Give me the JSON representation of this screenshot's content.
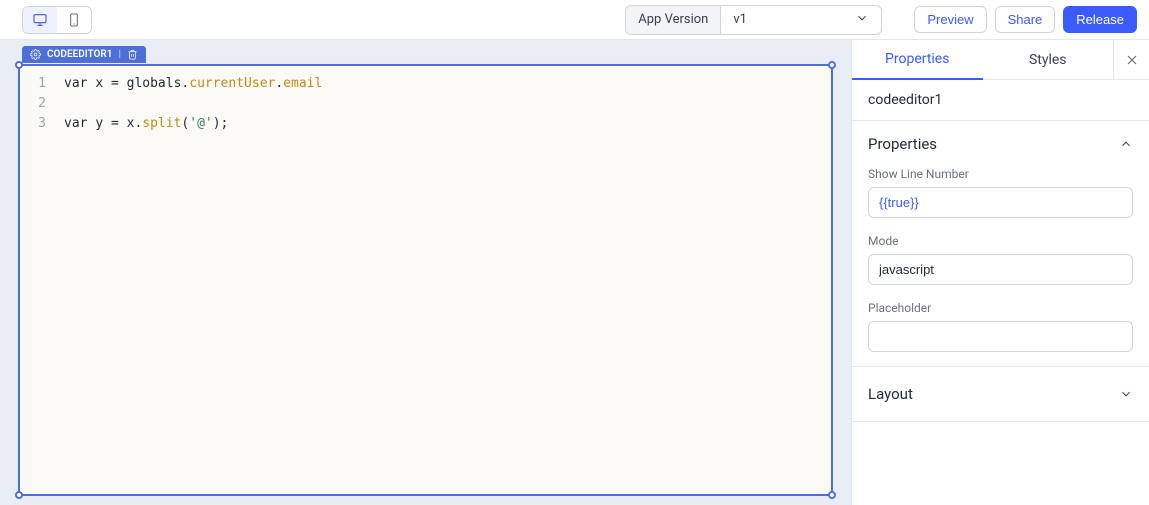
{
  "topbar": {
    "appVersionLabel": "App Version",
    "appVersionValue": "v1",
    "preview": "Preview",
    "share": "Share",
    "release": "Release"
  },
  "component": {
    "tag": "CODEEDITOR1",
    "lines": [
      {
        "num": "1",
        "html": "var x = globals.currentUser.email"
      },
      {
        "num": "2",
        "html": ""
      },
      {
        "num": "3",
        "html": "var y = x.split('@');"
      }
    ]
  },
  "panel": {
    "tabs": {
      "properties": "Properties",
      "styles": "Styles"
    },
    "title": "codeeditor1",
    "sectionProperties": "Properties",
    "showLineNumber": {
      "label": "Show Line Number",
      "value": "{{true}}"
    },
    "mode": {
      "label": "Mode",
      "value": "javascript"
    },
    "placeholder": {
      "label": "Placeholder",
      "value": ""
    },
    "sectionLayout": "Layout"
  }
}
